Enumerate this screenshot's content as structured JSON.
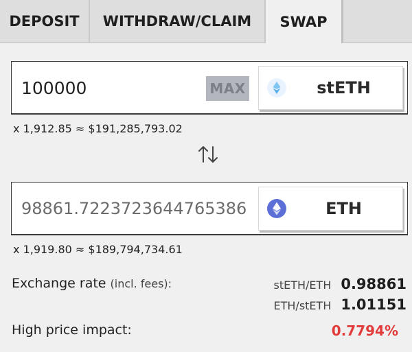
{
  "tabs": [
    {
      "label": "DEPOSIT"
    },
    {
      "label": "WITHDRAW/CLAIM"
    },
    {
      "label": "SWAP"
    }
  ],
  "from": {
    "amount": "100000",
    "max_label": "MAX",
    "token": "stETH",
    "icon": "steth-icon",
    "conversion": "x 1,912.85 ≈ $191,285,793.02"
  },
  "swap_icon": "swap-arrows-icon",
  "to": {
    "amount": "98861.7223723644765386",
    "token": "ETH",
    "icon": "eth-icon",
    "conversion": "x 1,919.80 ≈ $189,794,734.61"
  },
  "exchange": {
    "label": "Exchange rate",
    "label_note": "(incl. fees):",
    "rates": [
      {
        "pair": "stETH/ETH",
        "value": "0.98861"
      },
      {
        "pair": "ETH/stETH",
        "value": "1.01151"
      }
    ]
  },
  "impact": {
    "label": "High price impact:",
    "value": "0.7794%",
    "color": "#e23b3b"
  }
}
